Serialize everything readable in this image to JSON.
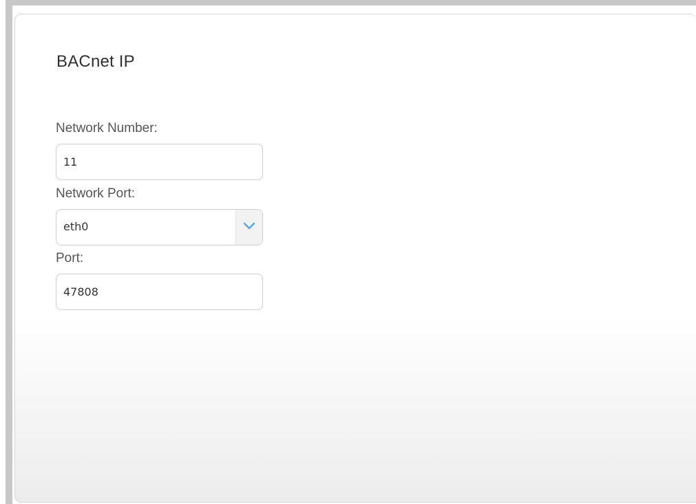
{
  "panel": {
    "title": "BACnet IP"
  },
  "form": {
    "network_number": {
      "label": "Network Number:",
      "value": "11"
    },
    "network_port": {
      "label": "Network Port:",
      "selected": "eth0"
    },
    "port": {
      "label": "Port:",
      "value": "47808"
    }
  },
  "colors": {
    "panel_border": "#d6d6d6",
    "frame_gray": "#c8c8c8",
    "arrow_blue": "#5aa6e6"
  },
  "icons": {
    "select_arrow": "chevron-down-icon"
  }
}
